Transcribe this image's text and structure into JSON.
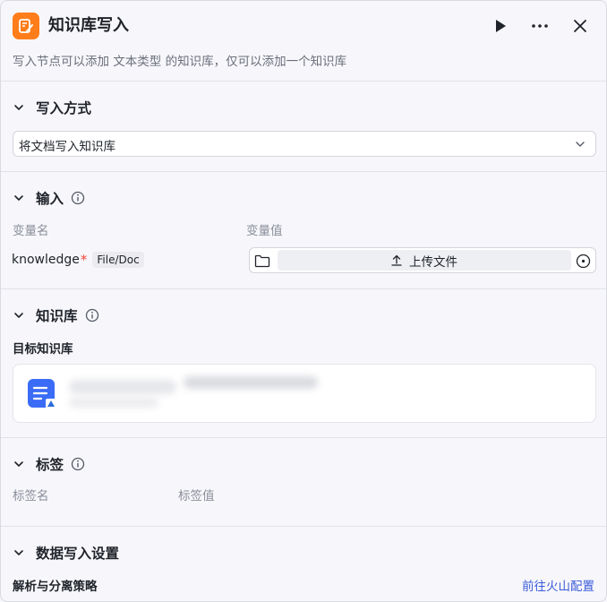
{
  "header": {
    "title": "知识库写入",
    "subtitle": "写入节点可以添加 文本类型 的知识库，仅可以添加一个知识库",
    "icons": [
      "knowledge-write-icon",
      "play-icon",
      "more-icon",
      "close-icon"
    ],
    "accent_color": "#ff7d1a"
  },
  "write_mode": {
    "section_title": "写入方式",
    "selected_value": "将文档写入知识库"
  },
  "input": {
    "section_title": "输入",
    "col_name_label": "变量名",
    "col_value_label": "变量值",
    "variable_name": "knowledge",
    "required_mark": "*",
    "type_badge": "File/Doc",
    "upload_label": "上传文件"
  },
  "knowledge_base": {
    "section_title": "知识库",
    "target_label": "目标知识库"
  },
  "tags": {
    "section_title": "标签",
    "col_name_label": "标签名",
    "col_value_label": "标签值"
  },
  "data_write_settings": {
    "section_title": "数据写入设置",
    "strategy_label": "解析与分离策略",
    "config_link": "前往火山配置"
  }
}
